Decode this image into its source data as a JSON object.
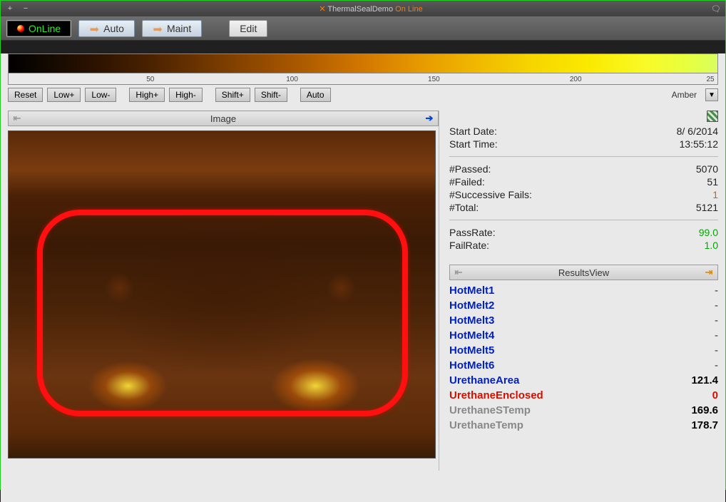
{
  "titlebar": {
    "app_prefix": "✕",
    "title": "ThermalSealDemo",
    "status": "On Line"
  },
  "toolbar": {
    "online": "OnLine",
    "auto": "Auto",
    "maint": "Maint",
    "edit": "Edit"
  },
  "gradient": {
    "ticks": [
      "50",
      "100",
      "150",
      "200",
      "25"
    ],
    "palette": "Amber",
    "buttons": {
      "reset": "Reset",
      "lowp": "Low+",
      "lowm": "Low-",
      "highp": "High+",
      "highm": "High-",
      "shiftp": "Shift+",
      "shiftm": "Shift-",
      "auto": "Auto"
    }
  },
  "image_panel": {
    "title": "Image"
  },
  "stats": {
    "start_date_label": "Start Date:",
    "start_date": "8/ 6/2014",
    "start_time_label": "Start Time:",
    "start_time": "13:55:12",
    "passed_label": "#Passed:",
    "passed": "5070",
    "failed_label": "#Failed:",
    "failed": "51",
    "succ_label": "#Successive Fails:",
    "succ": "1",
    "total_label": "#Total:",
    "total": "5121",
    "passrate_label": "PassRate:",
    "passrate": "99.0",
    "failrate_label": "FailRate:",
    "failrate": "1.0"
  },
  "results_panel": {
    "title": "ResultsView"
  },
  "results": [
    {
      "name": "HotMelt1",
      "cls": "blue",
      "val": "-",
      "vcls": "dash"
    },
    {
      "name": "HotMelt2",
      "cls": "blue",
      "val": "-",
      "vcls": "dash"
    },
    {
      "name": "HotMelt3",
      "cls": "blue",
      "val": "-",
      "vcls": "dash"
    },
    {
      "name": "HotMelt4",
      "cls": "blue",
      "val": "-",
      "vcls": "dash"
    },
    {
      "name": "HotMelt5",
      "cls": "blue",
      "val": "-",
      "vcls": "dash"
    },
    {
      "name": "HotMelt6",
      "cls": "blue",
      "val": "-",
      "vcls": "dash"
    },
    {
      "name": "UrethaneArea",
      "cls": "blue",
      "val": "121.4",
      "vcls": ""
    },
    {
      "name": "UrethaneEnclosed",
      "cls": "red",
      "val": "0",
      "vcls": "red"
    },
    {
      "name": "UrethaneSTemp",
      "cls": "grey",
      "val": "169.6",
      "vcls": "grey"
    },
    {
      "name": "UrethaneTemp",
      "cls": "grey",
      "val": "178.7",
      "vcls": "grey"
    }
  ]
}
